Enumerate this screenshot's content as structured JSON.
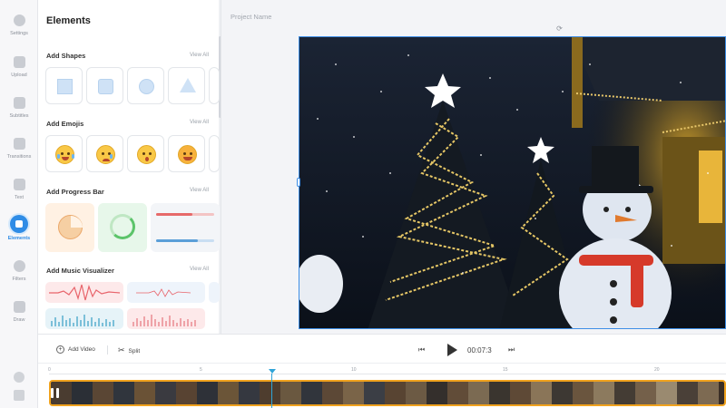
{
  "sidebar": {
    "items": [
      {
        "label": "Settings",
        "icon": "gear-icon"
      },
      {
        "label": "Upload",
        "icon": "upload-icon"
      },
      {
        "label": "Subtitles",
        "icon": "subtitles-icon"
      },
      {
        "label": "Transitions",
        "icon": "transitions-icon"
      },
      {
        "label": "Text",
        "icon": "text-icon"
      },
      {
        "label": "Elements",
        "icon": "elements-icon",
        "active": true
      },
      {
        "label": "Filters",
        "icon": "filters-icon"
      },
      {
        "label": "Draw",
        "icon": "pen-icon"
      }
    ],
    "bottom_icons": [
      "help-icon",
      "keyboard-icon"
    ]
  },
  "panel": {
    "title": "Elements",
    "sections": [
      {
        "title": "Add Shapes",
        "view_all": "View All"
      },
      {
        "title": "Add Emojis",
        "view_all": "View All"
      },
      {
        "title": "Add Progress Bar",
        "view_all": "View All"
      },
      {
        "title": "Add Music Visualizer",
        "view_all": "View All"
      }
    ]
  },
  "main": {
    "project_name": "Project Name"
  },
  "controls": {
    "add_video": "Add Video",
    "split": "Split",
    "timecode": "00:07:3"
  },
  "timeline": {
    "ticks": [
      "0",
      "5",
      "10",
      "15",
      "20"
    ]
  },
  "colors": {
    "accent": "#2f8ce6",
    "track_border": "#f0a21e",
    "playhead": "#2fa4d8"
  }
}
